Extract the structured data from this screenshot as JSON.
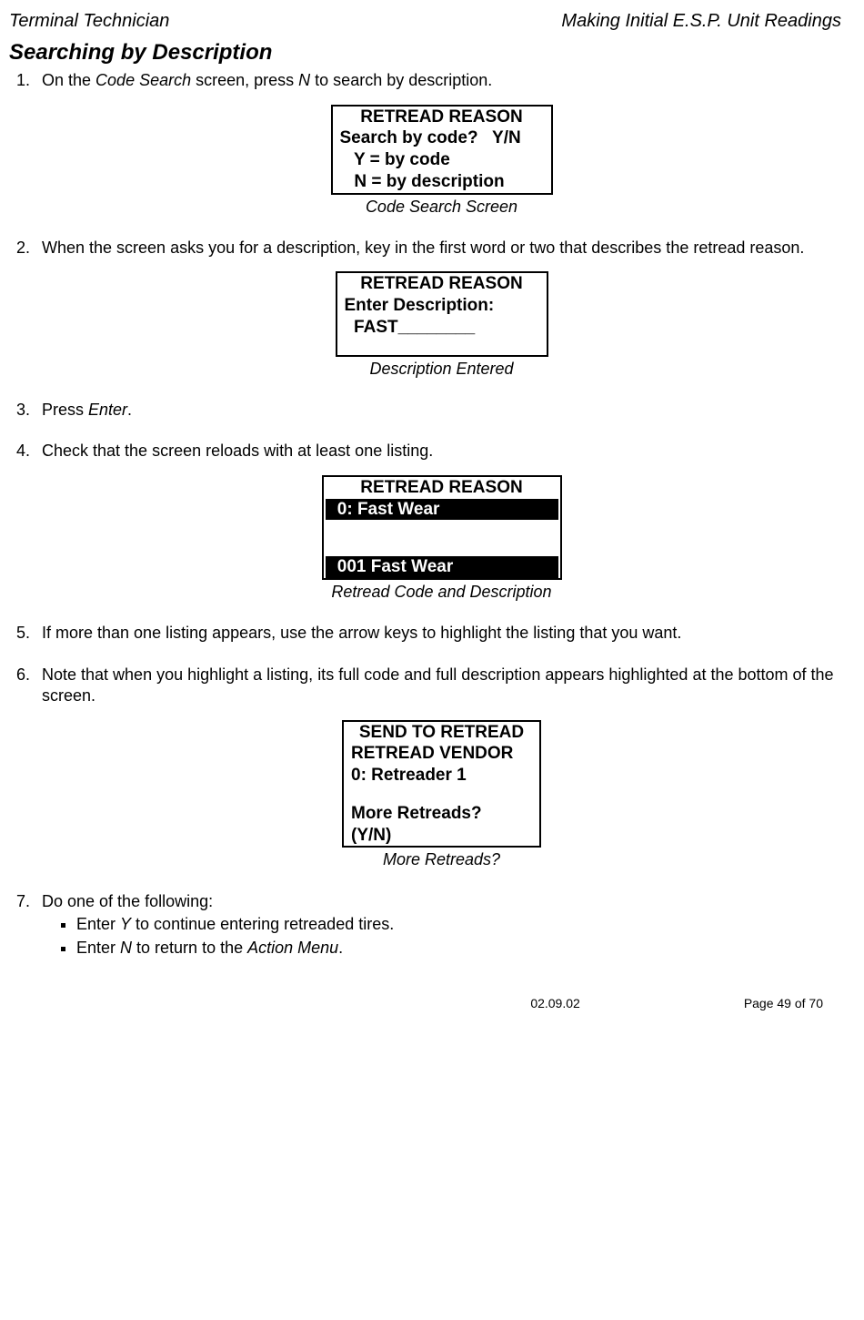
{
  "header": {
    "left": "Terminal Technician",
    "right": "Making Initial E.S.P. Unit Readings"
  },
  "section_title": "Searching by Description",
  "steps": {
    "s1": {
      "pre": "On the ",
      "em": "Code Search",
      "post": " screen, press ",
      "em2": "N",
      "post2": " to search by description."
    },
    "s2": "When the screen asks you for a description, key in the first word or two that describes the retread reason.",
    "s3_pre": "Press ",
    "s3_em": "Enter",
    "s3_post": ".",
    "s4": "Check that the screen reloads with at least one listing.",
    "s5": "If more than one listing appears, use the arrow keys to highlight the listing that you want.",
    "s6": "Note that when you highlight a listing, its full code and full description appears highlighted at the bottom of the screen.",
    "s7_lead": "Do one of the following:",
    "s7b1_pre": "Enter ",
    "s7b1_em": "Y",
    "s7b1_post": " to continue entering retreaded tires.",
    "s7b2_pre": "Enter ",
    "s7b2_em": "N",
    "s7b2_mid": " to return to the ",
    "s7b2_em2": "Action Menu",
    "s7b2_post": "."
  },
  "screens": {
    "sc1": {
      "l1": "RETREAD REASON",
      "l2": "Search by code?   Y/N",
      "l3": "   Y = by code",
      "l4": "   N = by description",
      "caption": "Code Search Screen"
    },
    "sc2": {
      "l1": "RETREAD REASON",
      "l2": "Enter Description:",
      "l3": "  FAST________",
      "caption": "Description Entered"
    },
    "sc3": {
      "l1": "RETREAD REASON",
      "l2": " 0: Fast Wear",
      "l3": " 001 Fast Wear",
      "caption": "Retread Code and Description"
    },
    "sc4": {
      "l1": "SEND TO RETREAD",
      "l2": "RETREAD VENDOR",
      "l3": "0: Retreader 1",
      "l4": "More Retreads?",
      "l5": "(Y/N)",
      "caption": "More Retreads?"
    }
  },
  "footer": {
    "date": "02.09.02",
    "page": "Page 49 of 70"
  }
}
